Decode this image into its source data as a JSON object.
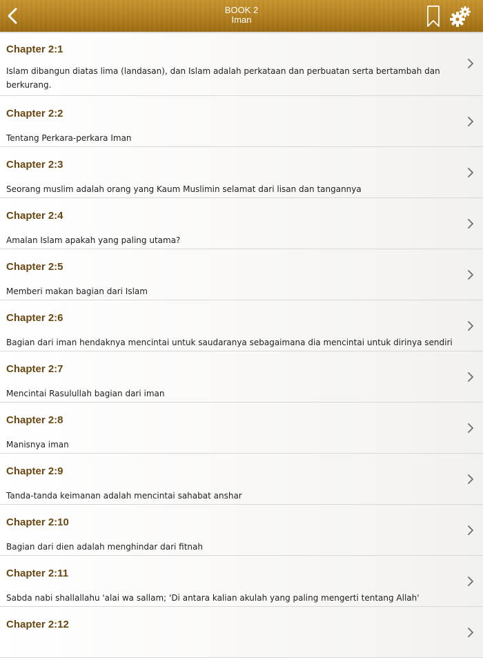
{
  "header": {
    "book_label": "BOOK 2",
    "book_title": "Iman",
    "back_icon": "chevron-left-icon",
    "bookmark_icon": "bookmark-icon",
    "settings_icon": "gears-icon",
    "bar_color": "#b5811f"
  },
  "chapters": [
    {
      "title": "Chapter 2:1",
      "desc": "Islam dibangun diatas lima (landasan), dan Islam adalah perkataan dan perbuatan serta bertambah dan berkurang."
    },
    {
      "title": "Chapter 2:2",
      "desc": "Tentang Perkara-perkara Iman"
    },
    {
      "title": "Chapter 2:3",
      "desc": "Seorang muslim adalah orang yang Kaum Muslimin selamat dari lisan dan tangannya"
    },
    {
      "title": "Chapter 2:4",
      "desc": "Amalan Islam apakah yang paling utama?"
    },
    {
      "title": "Chapter 2:5",
      "desc": "Memberi makan bagian dari Islam"
    },
    {
      "title": "Chapter 2:6",
      "desc": "Bagian dari iman hendaknya mencintai untuk saudaranya sebagaimana dia mencintai untuk dirinya sendiri"
    },
    {
      "title": "Chapter 2:7",
      "desc": "Mencintai Rasulullah bagian dari iman"
    },
    {
      "title": "Chapter 2:8",
      "desc": "Manisnya iman"
    },
    {
      "title": "Chapter 2:9",
      "desc": "Tanda-tanda keimanan adalah mencintai sahabat anshar"
    },
    {
      "title": "Chapter 2:10",
      "desc": "Bagian dari dien adalah menghindar dari fitnah"
    },
    {
      "title": "Chapter 2:11",
      "desc": "Sabda nabi shallallahu 'alai wa sallam; 'Di antara kalian akulah yang paling mengerti tentang Allah'"
    },
    {
      "title": "Chapter 2:12",
      "desc": ""
    }
  ],
  "colors": {
    "chapter_title": "#6a4612",
    "chevron": "#6e6e6e"
  }
}
